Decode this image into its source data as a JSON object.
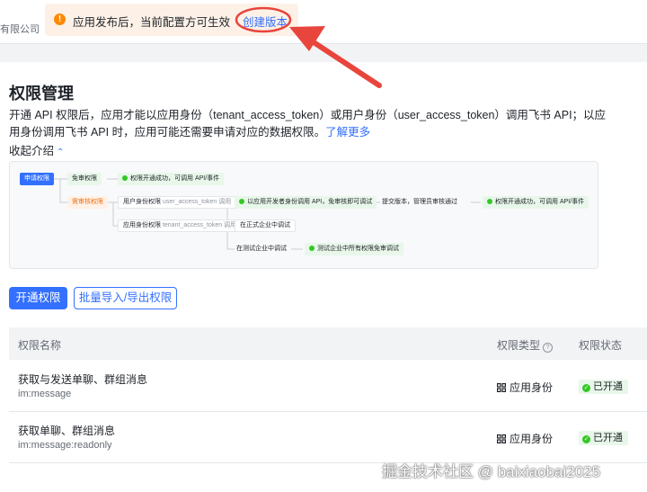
{
  "header": {
    "company_fragment": "有限公司",
    "notice": {
      "message": "应用发布后，当前配置方可生效",
      "link": "创建版本"
    }
  },
  "permissions": {
    "title": "权限管理",
    "description": "开通 API 权限后，应用才能以应用身份（tenant_access_token）或用户身份（user_access_token）调用飞书 API；以应用身份调用飞书 API 时，应用可能还需要申请对应的数据权限。",
    "learn_more": "了解更多",
    "collapse_label": "收起介绍"
  },
  "flow": {
    "apply": "申请权限",
    "no_review": "免审权限",
    "no_review_result": "权限开通成功，可调用 API/事件",
    "need_review": "需审核权限",
    "user_identity": "用户身份权限",
    "user_token": "user_access_token 调用",
    "user_debug": "以应用开发者身份调用 API，免审核即可调试",
    "submit": "提交版本，管理员审核通过",
    "final_result": "权限开通成功，可调用 API/事件",
    "app_identity": "应用身份权限",
    "app_token": "tenant_access_token 调用",
    "formal_debug": "在正式企业中调试",
    "test_debug": "在测试企业中调试",
    "test_result": "测试企业中所有权限免审调试"
  },
  "buttons": {
    "enable": "开通权限",
    "batch": "批量导入/导出权限"
  },
  "table": {
    "columns": {
      "name": "权限名称",
      "type": "权限类型",
      "status": "权限状态"
    },
    "rows": [
      {
        "name": "获取与发送单聊、群组消息",
        "code": "im:message",
        "type": "应用身份",
        "status": "已开通"
      },
      {
        "name": "获取单聊、群组消息",
        "code": "im:message:readonly",
        "type": "应用身份",
        "status": "已开通"
      }
    ]
  },
  "watermark": "掘金技术社区 @ baixiaobai2025",
  "colors": {
    "accent": "#3370ff",
    "success": "#34c724",
    "warning": "#ff8800",
    "annotation": "#e8453c"
  }
}
